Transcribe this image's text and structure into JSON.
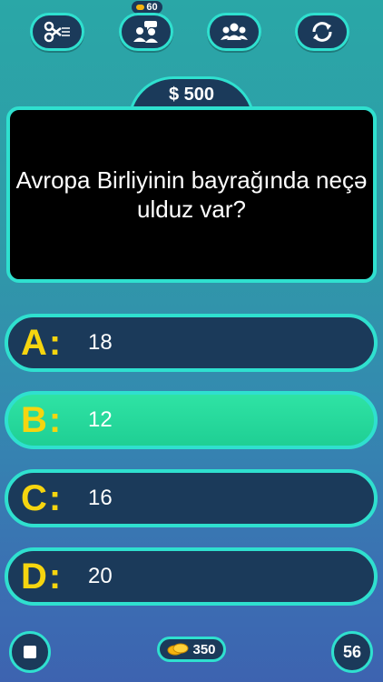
{
  "lifelines": {
    "fifty_fifty": {
      "icon": "scissors-icon"
    },
    "ask_friend": {
      "icon": "people-chat-icon",
      "cost": "60"
    },
    "audience": {
      "icon": "audience-icon"
    },
    "switch": {
      "icon": "refresh-icon"
    }
  },
  "prize": "$ 500",
  "question": "Avropa Birliyinin bayrağında neçə ulduz var?",
  "answers": [
    {
      "letter": "A:",
      "text": "18",
      "selected": false
    },
    {
      "letter": "B:",
      "text": "12",
      "selected": true
    },
    {
      "letter": "C:",
      "text": "16",
      "selected": false
    },
    {
      "letter": "D:",
      "text": "20",
      "selected": false
    }
  ],
  "bottom": {
    "coins": "350",
    "timer": "56"
  },
  "colors": {
    "accent": "#2fe0cf",
    "panel": "#1b3a5a",
    "letter": "#f6d50f",
    "selected": "#22d89a"
  }
}
